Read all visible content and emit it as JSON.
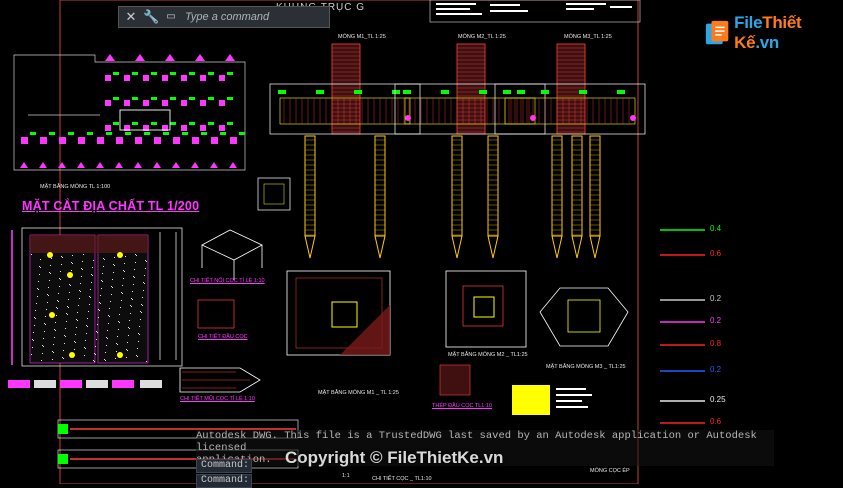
{
  "command_bar": {
    "placeholder": "Type a command",
    "close_icon": "close-icon",
    "settings_icon": "wrench-icon",
    "cmd_icon": "command-window-icon"
  },
  "drawing_title": "KHUNG TRỤC G",
  "brand": {
    "name_part1": "File",
    "name_part2": "Thiết Kế",
    "name_part3": ".vn"
  },
  "section_titles": {
    "geology": "MẶT CẮT ĐỊA CHẤT TL 1/200",
    "pile_detail": "CHI TIẾT NỐI CỌC TỈ LỆ 1:10",
    "pile_head": "CHI TIẾT ĐẦU CỌC",
    "pile_tip": "CHI TIẾT MŨI CỌC TỈ LỆ 1:10",
    "steel_detail": "THÉP ĐẦU CỌC TL1:10",
    "m1_plan": "MẶT BẰNG MÓNG M1 _ TL 1:25",
    "m2_plan": "MẶT BẰNG MÓNG M2 _ TL1:25",
    "m3_plan": "MẶT BẰNG MÓNG M3 _ TL1:25",
    "foundation_plan": "MẶT BẰNG MÓNG TL 1:100",
    "pile_label": "MÓNG CỌC ÉP",
    "scale_note": "1:1",
    "tl_note": "CHI TIẾT CỌC _ TL1:10"
  },
  "section_headers": {
    "m1": "MÓNG M1_TL 1:25",
    "m2": "MÓNG M2_TL 1:25",
    "m3": "MÓNG M3_TL 1:25"
  },
  "legend": [
    {
      "value": "0.4",
      "color": "#00ff00"
    },
    {
      "value": "0.6",
      "color": "#ff2020"
    },
    {
      "value": "0.2",
      "color": "#c8c8c8"
    },
    {
      "value": "0.2",
      "color": "#ff36ff"
    },
    {
      "value": "0.8",
      "color": "#ff2020"
    },
    {
      "value": "0.2",
      "color": "#2a5bff"
    },
    {
      "value": "0.25",
      "color": "#e8e8e8"
    },
    {
      "value": "0.6",
      "color": "#ff2020"
    }
  ],
  "command_history": {
    "line1": "Autodesk DWG.  This file is a TrustedDWG last saved by an Autodesk application or Autodesk licensed",
    "line2": "application.",
    "prompt1": "Command:",
    "prompt2": "Command:"
  },
  "watermark": "Copyright © FileThietKe.vn",
  "colors": {
    "background": "#000000",
    "rebar": "#ff4040",
    "pile": "#ffcc00",
    "markers": "#ff36ff",
    "green": "#00ff00",
    "frame": "#c63b3b"
  }
}
